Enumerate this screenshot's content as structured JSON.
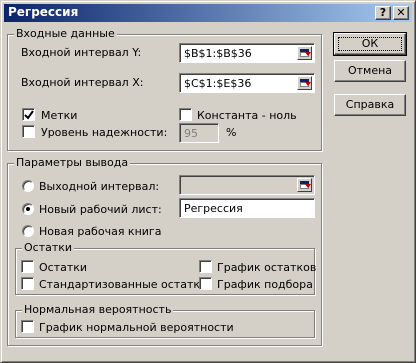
{
  "window": {
    "title": "Регрессия",
    "help_glyph": "?",
    "close_glyph": "✕"
  },
  "input_group": {
    "title": "Входные данные",
    "y_range_label": "Входной интервал Y:",
    "y_range_value": "$B$1:$B$36",
    "x_range_label": "Входной интервал X:",
    "x_range_value": "$C$1:$E$36",
    "labels_label": "Метки",
    "labels_checked": true,
    "constant_zero_label": "Константа - ноль",
    "constant_zero_checked": false,
    "confidence_label": "Уровень надежности:",
    "confidence_checked": false,
    "confidence_value": "95",
    "confidence_unit": "%"
  },
  "output_group": {
    "title": "Параметры вывода",
    "output_range_label": "Выходной интервал:",
    "output_range_value": "",
    "new_sheet_label": "Новый рабочий лист:",
    "new_sheet_value": "Регрессия",
    "new_workbook_label": "Новая рабочая книга",
    "selected_option": "new_sheet"
  },
  "residuals_group": {
    "title": "Остатки",
    "residuals_label": "Остатки",
    "standardized_label": "Стандартизованные остатки",
    "residual_plots_label": "График остатков",
    "line_fit_label": "График подбора"
  },
  "normal_group": {
    "title": "Нормальная вероятность",
    "normal_plot_label": "График нормальной вероятности"
  },
  "buttons": {
    "ok": "ОК",
    "cancel": "Отмена",
    "help": "Справка"
  }
}
